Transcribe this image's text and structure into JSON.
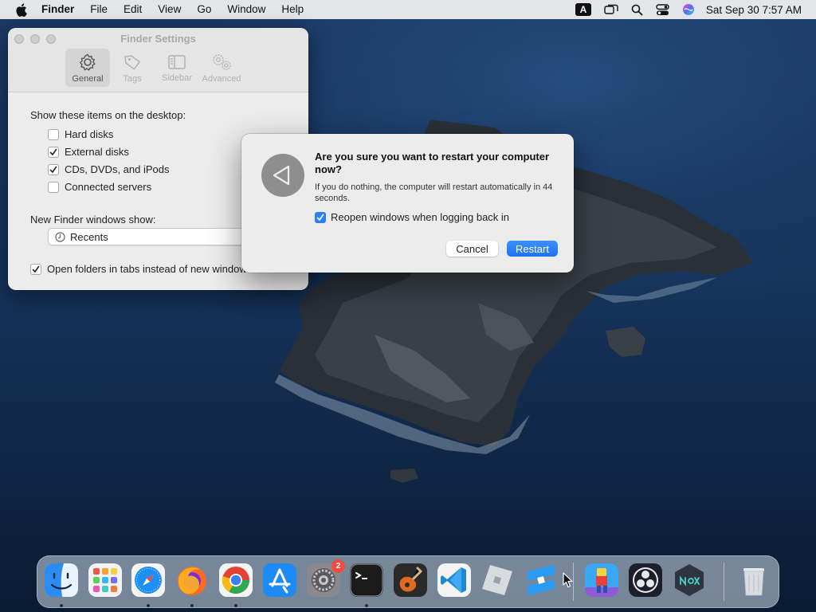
{
  "menubar": {
    "app_name": "Finder",
    "menus": [
      "File",
      "Edit",
      "View",
      "Go",
      "Window",
      "Help"
    ],
    "input_source": "A",
    "clock": "Sat Sep 30  7:57 AM"
  },
  "finder_settings": {
    "title": "Finder Settings",
    "tabs": [
      {
        "label": "General",
        "icon": "gear-icon",
        "selected": true
      },
      {
        "label": "Tags",
        "icon": "tag-icon",
        "selected": false
      },
      {
        "label": "Sidebar",
        "icon": "sidebar-icon",
        "selected": false
      },
      {
        "label": "Advanced",
        "icon": "gears-icon",
        "selected": false
      }
    ],
    "desktop_heading": "Show these items on the desktop:",
    "desktop_items": [
      {
        "label": "Hard disks",
        "checked": false
      },
      {
        "label": "External disks",
        "checked": true
      },
      {
        "label": "CDs, DVDs, and iPods",
        "checked": true
      },
      {
        "label": "Connected servers",
        "checked": false
      }
    ],
    "new_window_label": "New Finder windows show:",
    "new_window_value": "Recents",
    "open_in_tabs_label": "Open folders in tabs instead of new windows",
    "open_in_tabs_checked": true
  },
  "restart_dialog": {
    "title": "Are you sure you want to restart your computer now?",
    "message": "If you do nothing, the computer will restart automatically in 44 seconds.",
    "reopen_label": "Reopen windows when logging back in",
    "reopen_checked": true,
    "cancel_label": "Cancel",
    "restart_label": "Restart",
    "accent_color": "#2d7ff9"
  },
  "dock": {
    "items": [
      {
        "name": "finder",
        "running": true
      },
      {
        "name": "launchpad",
        "running": false
      },
      {
        "name": "safari",
        "running": true
      },
      {
        "name": "firefox",
        "running": true
      },
      {
        "name": "chrome",
        "running": true
      },
      {
        "name": "app-store",
        "running": false
      },
      {
        "name": "system-settings",
        "running": false,
        "badge": "2"
      },
      {
        "name": "terminal",
        "running": true
      },
      {
        "name": "garageband",
        "running": false
      },
      {
        "name": "vscode",
        "running": false
      },
      {
        "name": "roblox",
        "running": false
      },
      {
        "name": "roblox-studio",
        "running": false
      },
      {
        "name": "subway-surfers",
        "running": false
      },
      {
        "name": "obs",
        "running": false
      },
      {
        "name": "nox",
        "running": false
      },
      {
        "name": "trash",
        "running": false
      }
    ]
  }
}
